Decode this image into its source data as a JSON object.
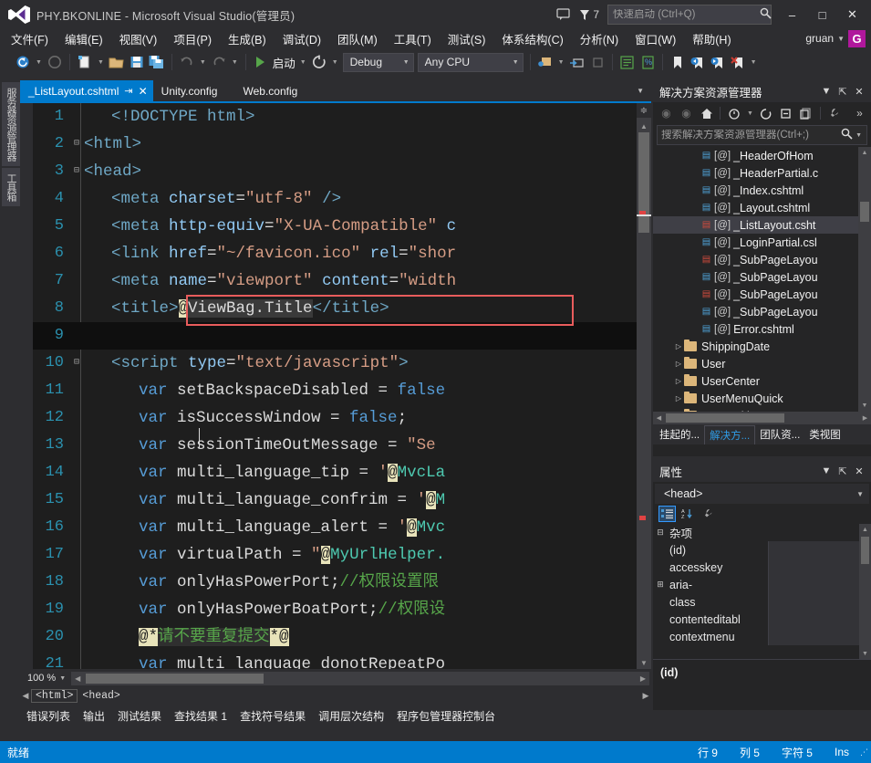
{
  "window": {
    "title": "PHY.BKONLINE - Microsoft Visual Studio(管理员)",
    "feedback_count": "7",
    "minimize": "–",
    "maximize": "□",
    "close": "✕"
  },
  "quick_launch": {
    "placeholder": "快速启动 (Ctrl+Q)",
    "value": ""
  },
  "menu": {
    "items": [
      "文件(F)",
      "编辑(E)",
      "视图(V)",
      "项目(P)",
      "生成(B)",
      "调试(D)",
      "团队(M)",
      "工具(T)",
      "测试(S)",
      "体系结构(C)",
      "分析(N)",
      "窗口(W)",
      "帮助(H)"
    ],
    "account_name": "gruan",
    "avatar_letter": "G"
  },
  "toolbar": {
    "run_label": "启动",
    "config": "Debug",
    "platform": "Any CPU"
  },
  "left_dock": {
    "tabs": [
      "服务器资源管理器",
      "工具箱"
    ]
  },
  "editor": {
    "tabs": [
      {
        "name": "_ListLayout.cshtml",
        "active": true,
        "pin": "⇥",
        "close": "✕"
      },
      {
        "name": "Unity.config",
        "active": false
      },
      {
        "name": "Web.config",
        "active": false
      }
    ],
    "zoom": "100 %",
    "breadcrumb": [
      "<html>",
      "<head>"
    ],
    "lines": [
      {
        "n": "1",
        "fold": "",
        "indent": 1,
        "tokens": [
          {
            "t": "<!DOCTYPE ",
            "c": "t-tag"
          },
          {
            "t": "html>",
            "c": "t-tag"
          }
        ]
      },
      {
        "n": "2",
        "fold": "⊟",
        "indent": 0,
        "tokens": [
          {
            "t": "<html>",
            "c": "t-tag"
          }
        ]
      },
      {
        "n": "3",
        "fold": "⊟",
        "indent": 0,
        "tokens": [
          {
            "t": "<head>",
            "c": "t-tag"
          }
        ]
      },
      {
        "n": "4",
        "fold": "",
        "indent": 1,
        "tokens": [
          {
            "t": "<meta ",
            "c": "t-tag"
          },
          {
            "t": "charset",
            "c": "t-attr"
          },
          {
            "t": "=",
            "c": "t-plain"
          },
          {
            "t": "\"utf-8\"",
            "c": "t-str"
          },
          {
            "t": " />",
            "c": "t-tag"
          }
        ]
      },
      {
        "n": "5",
        "fold": "",
        "indent": 1,
        "tokens": [
          {
            "t": "<meta ",
            "c": "t-tag"
          },
          {
            "t": "http-equiv",
            "c": "t-attr"
          },
          {
            "t": "=",
            "c": "t-plain"
          },
          {
            "t": "\"X-UA-Compatible\"",
            "c": "t-str"
          },
          {
            "t": " c",
            "c": "t-attr"
          }
        ]
      },
      {
        "n": "6",
        "fold": "",
        "indent": 1,
        "tokens": [
          {
            "t": "<link ",
            "c": "t-tag"
          },
          {
            "t": "href",
            "c": "t-attr"
          },
          {
            "t": "=",
            "c": "t-plain"
          },
          {
            "t": "\"~/favicon.ico\"",
            "c": "t-str"
          },
          {
            "t": " rel",
            "c": "t-attr"
          },
          {
            "t": "=",
            "c": "t-plain"
          },
          {
            "t": "\"shor",
            "c": "t-str"
          }
        ]
      },
      {
        "n": "7",
        "fold": "",
        "indent": 1,
        "tokens": [
          {
            "t": "<meta ",
            "c": "t-tag"
          },
          {
            "t": "name",
            "c": "t-attr"
          },
          {
            "t": "=",
            "c": "t-plain"
          },
          {
            "t": "\"viewport\"",
            "c": "t-str"
          },
          {
            "t": " content",
            "c": "t-attr"
          },
          {
            "t": "=",
            "c": "t-plain"
          },
          {
            "t": "\"width",
            "c": "t-str"
          }
        ]
      },
      {
        "n": "8",
        "fold": "",
        "indent": 1,
        "tokens": [
          {
            "t": "<title>",
            "c": "t-tag"
          },
          {
            "t": "@",
            "c": "t-razor"
          },
          {
            "t": "ViewBag.Title",
            "c": "t-rzfield"
          },
          {
            "t": "</title>",
            "c": "t-tag"
          }
        ]
      },
      {
        "n": "9",
        "fold": "",
        "indent": 1,
        "current": true,
        "tokens": []
      },
      {
        "n": "10",
        "fold": "⊟",
        "indent": 1,
        "tokens": [
          {
            "t": "<script ",
            "c": "t-tag"
          },
          {
            "t": "type",
            "c": "t-attr"
          },
          {
            "t": "=",
            "c": "t-plain"
          },
          {
            "t": "\"text/javascript\"",
            "c": "t-str"
          },
          {
            "t": ">",
            "c": "t-tag"
          }
        ]
      },
      {
        "n": "11",
        "fold": "",
        "indent": 2,
        "tokens": [
          {
            "t": "var ",
            "c": "t-kw"
          },
          {
            "t": "setBackspaceDisabled = ",
            "c": "t-plain"
          },
          {
            "t": "false",
            "c": "t-kw"
          }
        ]
      },
      {
        "n": "12",
        "fold": "",
        "indent": 2,
        "tokens": [
          {
            "t": "var ",
            "c": "t-kw"
          },
          {
            "t": "isSuccessWindow = ",
            "c": "t-plain"
          },
          {
            "t": "false",
            "c": "t-kw"
          },
          {
            "t": ";",
            "c": "t-plain"
          }
        ]
      },
      {
        "n": "13",
        "fold": "",
        "indent": 2,
        "tokens": [
          {
            "t": "var ",
            "c": "t-kw"
          },
          {
            "t": "sessionTimeOutMessage = ",
            "c": "t-plain"
          },
          {
            "t": "\"Se",
            "c": "t-str"
          }
        ]
      },
      {
        "n": "14",
        "fold": "",
        "indent": 2,
        "tokens": [
          {
            "t": "var ",
            "c": "t-kw"
          },
          {
            "t": "multi_language_tip = ",
            "c": "t-plain"
          },
          {
            "t": "'",
            "c": "t-str"
          },
          {
            "t": "@",
            "c": "t-razor"
          },
          {
            "t": "MvcLa",
            "c": "t-teal"
          }
        ]
      },
      {
        "n": "15",
        "fold": "",
        "indent": 2,
        "tokens": [
          {
            "t": "var ",
            "c": "t-kw"
          },
          {
            "t": "multi_language_confrim = ",
            "c": "t-plain"
          },
          {
            "t": "'",
            "c": "t-str"
          },
          {
            "t": "@",
            "c": "t-razor"
          },
          {
            "t": "M",
            "c": "t-teal"
          }
        ]
      },
      {
        "n": "16",
        "fold": "",
        "indent": 2,
        "tokens": [
          {
            "t": "var ",
            "c": "t-kw"
          },
          {
            "t": "multi_language_alert = ",
            "c": "t-plain"
          },
          {
            "t": "'",
            "c": "t-str"
          },
          {
            "t": "@",
            "c": "t-razor"
          },
          {
            "t": "Mvc",
            "c": "t-teal"
          }
        ]
      },
      {
        "n": "17",
        "fold": "",
        "indent": 2,
        "tokens": [
          {
            "t": "var ",
            "c": "t-kw"
          },
          {
            "t": "virtualPath = ",
            "c": "t-plain"
          },
          {
            "t": "\"",
            "c": "t-str"
          },
          {
            "t": "@",
            "c": "t-razor"
          },
          {
            "t": "MyUrlHelper.",
            "c": "t-teal"
          }
        ]
      },
      {
        "n": "18",
        "fold": "",
        "indent": 2,
        "tokens": [
          {
            "t": "var ",
            "c": "t-kw"
          },
          {
            "t": "onlyHasPowerPort;",
            "c": "t-plain"
          },
          {
            "t": "//权限设置限",
            "c": "t-cmt"
          }
        ]
      },
      {
        "n": "19",
        "fold": "",
        "indent": 2,
        "tokens": [
          {
            "t": "var ",
            "c": "t-kw"
          },
          {
            "t": "onlyHasPowerBoatPort;",
            "c": "t-plain"
          },
          {
            "t": "//权限设",
            "c": "t-cmt"
          }
        ]
      },
      {
        "n": "20",
        "fold": "",
        "indent": 2,
        "tokens": [
          {
            "t": "@*",
            "c": "t-razor"
          },
          {
            "t": "请不要重复提交",
            "c": "t-cmt t-cmt-hl"
          },
          {
            "t": "*@",
            "c": "t-razor"
          }
        ]
      },
      {
        "n": "21",
        "fold": "",
        "indent": 2,
        "tokens": [
          {
            "t": "var ",
            "c": "t-kw"
          },
          {
            "t": "multi_language_donotRepeatPo",
            "c": "t-plain"
          }
        ]
      }
    ],
    "bottom_tabs": [
      "错误列表",
      "输出",
      "测试结果",
      "查找结果 1",
      "查找符号结果",
      "调用层次结构",
      "程序包管理器控制台"
    ]
  },
  "solution_explorer": {
    "title": "解决方案资源管理器",
    "search_placeholder": "搜索解决方案资源管理器(Ctrl+;)",
    "search_value": "",
    "items": [
      {
        "label": "_HeaderOfHom",
        "kind": "cshtml",
        "tag": "[@]",
        "indent": 2,
        "selected": false
      },
      {
        "label": "_HeaderPartial.c",
        "kind": "cshtml",
        "tag": "[@]",
        "indent": 2,
        "selected": false
      },
      {
        "label": "_Index.cshtml",
        "kind": "cshtml",
        "tag": "[@]",
        "indent": 2,
        "selected": false
      },
      {
        "label": "_Layout.cshtml",
        "kind": "cshtml",
        "tag": "[@]",
        "indent": 2,
        "selected": false
      },
      {
        "label": "_ListLayout.csht",
        "kind": "cshtml-red",
        "tag": "[@]",
        "indent": 2,
        "selected": true
      },
      {
        "label": "_LoginPartial.csl",
        "kind": "cshtml",
        "tag": "[@]",
        "indent": 2,
        "selected": false
      },
      {
        "label": "_SubPageLayou",
        "kind": "cshtml-red",
        "tag": "[@]",
        "indent": 2,
        "selected": false
      },
      {
        "label": "_SubPageLayou",
        "kind": "cshtml",
        "tag": "[@]",
        "indent": 2,
        "selected": false
      },
      {
        "label": "_SubPageLayou",
        "kind": "cshtml-red",
        "tag": "[@]",
        "indent": 2,
        "selected": false
      },
      {
        "label": "_SubPageLayou",
        "kind": "cshtml",
        "tag": "[@]",
        "indent": 2,
        "selected": false
      },
      {
        "label": "Error.cshtml",
        "kind": "cshtml",
        "tag": "[@]",
        "indent": 2,
        "selected": false
      },
      {
        "label": "ShippingDate",
        "kind": "folder",
        "indent": 1,
        "expander": "▷",
        "selected": false
      },
      {
        "label": "User",
        "kind": "folder",
        "indent": 1,
        "expander": "▷",
        "selected": false
      },
      {
        "label": "UserCenter",
        "kind": "folder",
        "indent": 1,
        "expander": "▷",
        "selected": false
      },
      {
        "label": "UserMenuQuick",
        "kind": "folder",
        "indent": 1,
        "expander": "▷",
        "selected": false
      },
      {
        "label": "UserMulti",
        "kind": "folder",
        "indent": 1,
        "expander": "▷",
        "selected": false
      }
    ],
    "tabs": [
      {
        "label": "挂起的...",
        "active": false
      },
      {
        "label": "解决方...",
        "active": true
      },
      {
        "label": "团队资...",
        "active": false
      },
      {
        "label": "类视图",
        "active": false
      }
    ]
  },
  "properties": {
    "title": "属性",
    "object": "<head>",
    "category": "杂项",
    "rows": [
      {
        "name": "(id)",
        "expander": "",
        "value": ""
      },
      {
        "name": "accesskey",
        "expander": "",
        "value": ""
      },
      {
        "name": "aria-",
        "expander": "⊞",
        "value": ""
      },
      {
        "name": "class",
        "expander": "",
        "value": ""
      },
      {
        "name": "contenteditabl",
        "expander": "",
        "value": ""
      },
      {
        "name": "contextmenu",
        "expander": "",
        "value": ""
      }
    ],
    "description": "(id)"
  },
  "status": {
    "ready": "就绪",
    "line": "行 9",
    "column": "列 5",
    "char": "字符 5",
    "insert": "Ins"
  },
  "colors": {
    "accent": "#007acc",
    "window_bg": "#2d2d30",
    "editor_bg": "#1e1e1e",
    "avatar": "#b0179c",
    "annotation_red": "#e85c5c"
  }
}
